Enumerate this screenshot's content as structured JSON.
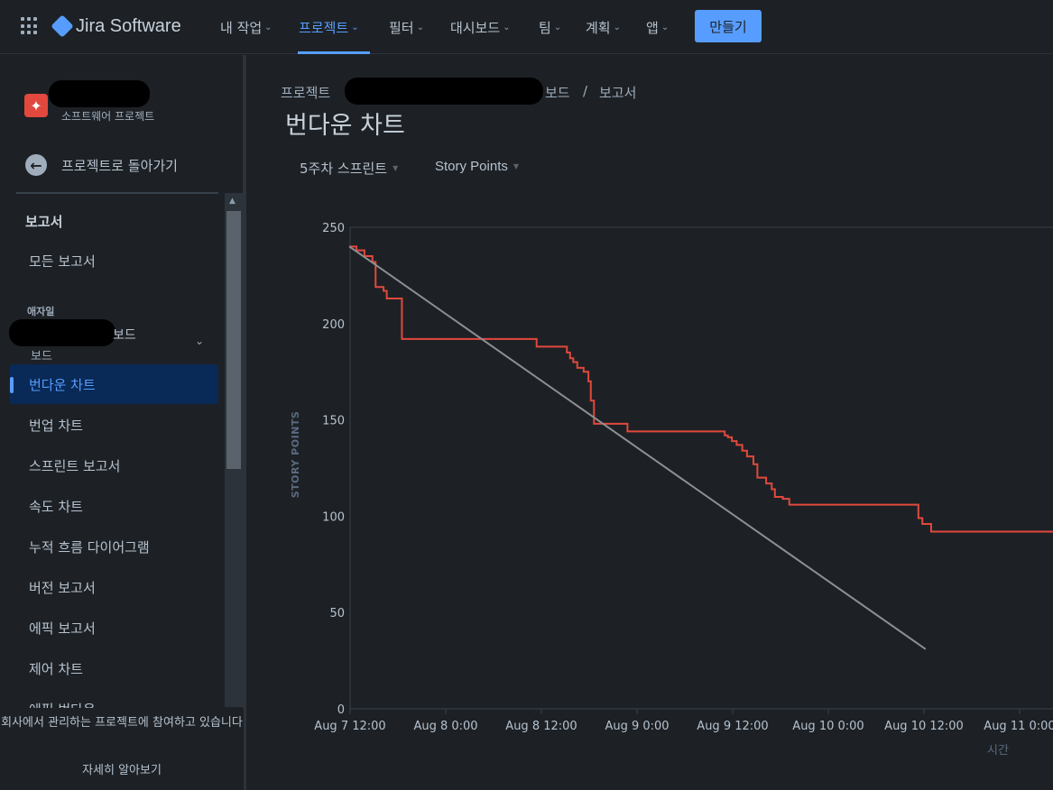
{
  "app": {
    "product_name": "Jira Software"
  },
  "nav": {
    "items": [
      "내 작업",
      "프로젝트",
      "필터",
      "대시보드",
      "팀",
      "계획",
      "앱"
    ],
    "active": "프로젝트",
    "create_label": "만들기"
  },
  "sidebar": {
    "project_type": "소프트웨어 프로젝트",
    "back_label": "프로젝트로 돌아가기",
    "reports_heading": "보고서",
    "all_reports": "모든 보고서",
    "agile_heading": "애자일",
    "board_label": "보드",
    "board_sub": "보드",
    "items": [
      "번다운 차트",
      "번업 차트",
      "스프린트 보고서",
      "속도 차트",
      "누적 흐름 다이어그램",
      "버전 보고서",
      "에픽 보고서",
      "제어 차트",
      "에픽 번다운"
    ],
    "active_item": "번다운 차트",
    "footer_message": "회사에서 관리하는 프로젝트에 참여하고 있습니다",
    "footer_link": "자세히 알아보기"
  },
  "breadcrumb": {
    "first": "프로젝트",
    "sep": "/",
    "board": "보드",
    "last": "보고서"
  },
  "page_title": "번다운 차트",
  "filters": {
    "sprint": "5주차 스프린트",
    "estimate": "Story Points"
  },
  "colors": {
    "accent": "#579dff",
    "remaining": "#e2483d",
    "guideline": "#8c8f93",
    "background": "#1d2125"
  },
  "chart_data": {
    "type": "line",
    "ylabel": "STORY POINTS",
    "xlabel": "시간",
    "ylim": [
      0,
      250
    ],
    "yticks": [
      0,
      50,
      100,
      150,
      200,
      250
    ],
    "x_unit": "hours since Aug 7 00:00",
    "xlim": [
      12,
      84
    ],
    "xticks": [
      {
        "value": 12,
        "label": "Aug 7 12:00"
      },
      {
        "value": 24,
        "label": "Aug 8 0:00"
      },
      {
        "value": 36,
        "label": "Aug 8 12:00"
      },
      {
        "value": 48,
        "label": "Aug 9 0:00"
      },
      {
        "value": 60,
        "label": "Aug 9 12:00"
      },
      {
        "value": 72,
        "label": "Aug 10 0:00"
      },
      {
        "value": 84,
        "label": "Aug 10 12:00"
      },
      {
        "value": 96,
        "label": "Aug 11 0:00"
      }
    ],
    "series": [
      {
        "name": "remaining",
        "step": true,
        "points": [
          [
            11.9,
            240
          ],
          [
            12.8,
            238
          ],
          [
            13.8,
            235
          ],
          [
            14.8,
            232
          ],
          [
            15.2,
            219
          ],
          [
            16.2,
            217
          ],
          [
            16.6,
            213
          ],
          [
            18.1,
            213
          ],
          [
            18.5,
            192
          ],
          [
            35.4,
            192
          ],
          [
            35.4,
            188
          ],
          [
            38.8,
            188
          ],
          [
            39.2,
            185
          ],
          [
            39.6,
            182
          ],
          [
            40.0,
            180
          ],
          [
            40.5,
            177
          ],
          [
            41.3,
            175
          ],
          [
            41.9,
            170
          ],
          [
            42.2,
            160
          ],
          [
            42.6,
            148
          ],
          [
            46.8,
            148
          ],
          [
            46.8,
            144
          ],
          [
            58.7,
            144
          ],
          [
            59.0,
            142
          ],
          [
            59.4,
            141
          ],
          [
            59.9,
            139
          ],
          [
            60.5,
            137
          ],
          [
            61.2,
            134
          ],
          [
            61.8,
            131
          ],
          [
            62.6,
            127
          ],
          [
            63.1,
            120
          ],
          [
            64.2,
            117
          ],
          [
            64.9,
            114
          ],
          [
            65.3,
            110
          ],
          [
            66.3,
            109
          ],
          [
            67.1,
            106
          ],
          [
            82.6,
            106
          ],
          [
            83.3,
            99
          ],
          [
            83.8,
            96
          ],
          [
            84.9,
            92
          ]
        ]
      },
      {
        "name": "guideline",
        "step": false,
        "points": [
          [
            11.9,
            240
          ],
          [
            84.2,
            31
          ]
        ]
      }
    ]
  }
}
